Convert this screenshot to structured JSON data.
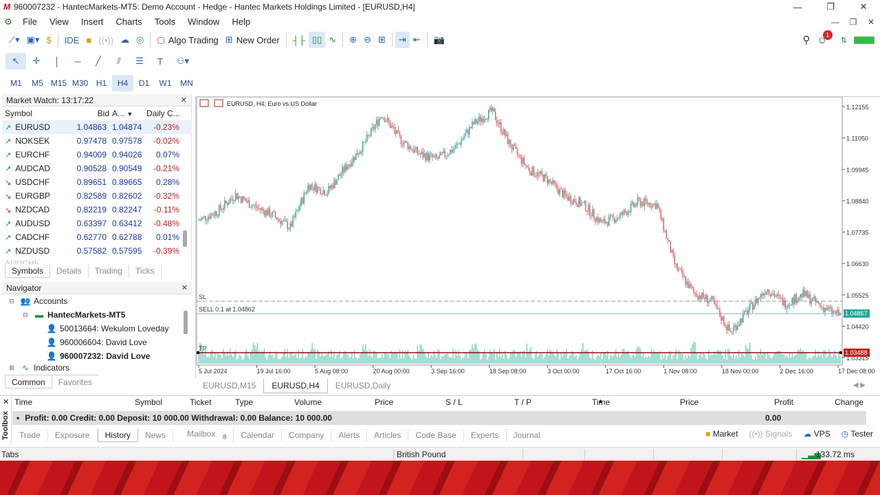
{
  "window": {
    "title": "960007232 - HantecMarkets-MT5: Demo Account - Hedge - Hantec Markets Holdings Limited - [EURUSD,H4]",
    "minimize": "—",
    "restore": "❐",
    "close": "✕"
  },
  "menu": [
    "File",
    "View",
    "Insert",
    "Charts",
    "Tools",
    "Window",
    "Help"
  ],
  "toolbar1": {
    "ide_label": "IDE",
    "algo_trading_label": "Algo Trading",
    "new_order_label": "New Order",
    "notification_count": "1"
  },
  "timeframes": [
    "M1",
    "M5",
    "M15",
    "M30",
    "H1",
    "H4",
    "D1",
    "W1",
    "MN"
  ],
  "active_timeframe": "H4",
  "market_watch": {
    "title": "Market Watch: 13:17:22",
    "headers": [
      "Symbol",
      "Bid",
      "A...",
      "Daily C..."
    ],
    "rows": [
      {
        "symbol": "EURUSD",
        "bid": "1.04863",
        "ask": "1.04874",
        "change": "-0.23%",
        "dir": "up"
      },
      {
        "symbol": "NOKSEK",
        "bid": "0.97478",
        "ask": "0.97578",
        "change": "-0.02%",
        "dir": "up"
      },
      {
        "symbol": "EURCHF",
        "bid": "0.94009",
        "ask": "0.94026",
        "change": "0.07%",
        "dir": "up"
      },
      {
        "symbol": "AUDCAD",
        "bid": "0.90528",
        "ask": "0.90549",
        "change": "-0.21%",
        "dir": "up"
      },
      {
        "symbol": "USDCHF",
        "bid": "0.89651",
        "ask": "0.89665",
        "change": "0.28%",
        "dir": "down"
      },
      {
        "symbol": "EURGBP",
        "bid": "0.82589",
        "ask": "0.82602",
        "change": "-0.32%",
        "dir": "down"
      },
      {
        "symbol": "NZDCAD",
        "bid": "0.82219",
        "ask": "0.82247",
        "change": "-0.11%",
        "dir": "down"
      },
      {
        "symbol": "AUDUSD",
        "bid": "0.63397",
        "ask": "0.63412",
        "change": "-0.48%",
        "dir": "up"
      },
      {
        "symbol": "CADCHF",
        "bid": "0.62770",
        "ask": "0.62788",
        "change": "0.01%",
        "dir": "up"
      },
      {
        "symbol": "NZDUSD",
        "bid": "0.57582",
        "ask": "0.57595",
        "change": "-0.39%",
        "dir": "up"
      }
    ],
    "tabs": [
      "Symbols",
      "Details",
      "Trading",
      "Ticks"
    ]
  },
  "navigator": {
    "title": "Navigator",
    "accounts_label": "Accounts",
    "server_label": "HantecMarkets-MT5",
    "accounts": [
      "50013664: Wekulom Loveday",
      "960006604: David Love",
      "960007232: David Love"
    ],
    "indicators_label": "Indicators",
    "tabs": [
      "Common",
      "Favorites"
    ]
  },
  "chart": {
    "header": "EURUSD, H4:  Euro vs US Dollar",
    "sl_label": "SL",
    "tp_label": "TP",
    "order_label": "SELL 0.1 at 1.04862",
    "current_price_label": "1.04867",
    "tp_price_label": "1.03488",
    "tabs": [
      "EURUSD,M15",
      "EURUSD,H4",
      "EURUSD,Daily"
    ],
    "active_tab": "EURUSD,H4",
    "tab_arrows": "◀ ▶"
  },
  "chart_data": {
    "type": "candlestick",
    "symbol": "EURUSD",
    "timeframe": "H4",
    "y_ticks": [
      "1.12155",
      "1.11050",
      "1.09945",
      "1.08840",
      "1.07735",
      "1.06630",
      "1.05525",
      "1.04420",
      "1.03315"
    ],
    "ylim": [
      1.031,
      1.124
    ],
    "x_ticks": [
      "5 Jul 2024",
      "19 Jul 16:00",
      "5 Aug 08:00",
      "20 Aug 00:00",
      "3 Sep 16:00",
      "18 Sep 08:00",
      "3 Oct 00:00",
      "17 Oct 16:00",
      "1 Nov 08:00",
      "18 Nov 00:00",
      "2 Dec 16:00",
      "17 Dec 08:00"
    ],
    "price_path": [
      1.0815,
      1.0845,
      1.0905,
      1.0865,
      1.0835,
      1.079,
      1.094,
      1.0915,
      1.1,
      1.108,
      1.119,
      1.11,
      1.105,
      1.103,
      1.107,
      1.1155,
      1.12,
      1.108,
      1.0995,
      1.096,
      1.09,
      1.087,
      1.0805,
      1.083,
      1.088,
      1.087,
      1.0655,
      1.056,
      1.053,
      1.042,
      1.05,
      1.0575,
      1.052,
      1.0555,
      1.051,
      1.048
    ],
    "sl": 1.053,
    "entry": 1.04862,
    "current": 1.04867,
    "tp": 1.03488
  },
  "toolbox": {
    "side_label": "Toolbox",
    "columns": [
      "Time",
      "Symbol",
      "Ticket",
      "Type",
      "Volume",
      "Price",
      "S / L",
      "T / P",
      "Time",
      "Price",
      "Profit",
      "Change"
    ],
    "summary": "Profit: 0.00  Credit: 0.00  Deposit: 10 000.00  Withdrawal: 0.00  Balance: 10 000.00",
    "summary_profit": "0.00",
    "tabs": [
      "Trade",
      "Exposure",
      "History",
      "News",
      "Mailbox",
      "Calendar",
      "Company",
      "Alerts",
      "Articles",
      "Code Base",
      "Experts",
      "Journal"
    ],
    "active_tab": "History",
    "mailbox_count": "8",
    "right_links": [
      "Market",
      "Signals",
      "VPS",
      "Tester"
    ]
  },
  "statusbar": {
    "left": "Tabs",
    "middle": "British Pound",
    "ping": "133.72 ms"
  }
}
